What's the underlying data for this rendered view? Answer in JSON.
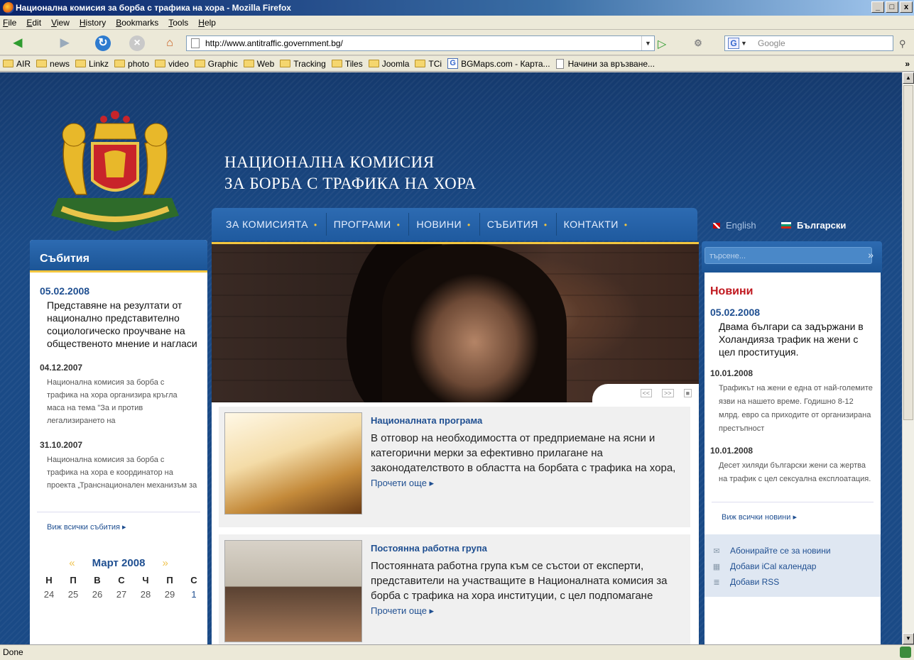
{
  "window": {
    "title": "Национална комисия за борба с трафика на хора - Mozilla Firefox",
    "controls": [
      "_",
      "□",
      "x"
    ]
  },
  "menu": [
    "File",
    "Edit",
    "View",
    "History",
    "Bookmarks",
    "Tools",
    "Help"
  ],
  "navbar": {
    "url": "http://www.antitraffic.government.bg/",
    "search_placeholder": "Google"
  },
  "bookmarks": [
    {
      "label": "AIR",
      "icon": "folder-icon"
    },
    {
      "label": "news",
      "icon": "folder-icon"
    },
    {
      "label": "Linkz",
      "icon": "folder-icon"
    },
    {
      "label": "photo",
      "icon": "folder-icon"
    },
    {
      "label": "video",
      "icon": "folder-icon"
    },
    {
      "label": "Graphic",
      "icon": "folder-icon"
    },
    {
      "label": "Web",
      "icon": "folder-icon"
    },
    {
      "label": "Tracking",
      "icon": "folder-icon"
    },
    {
      "label": "Tiles",
      "icon": "folder-icon"
    },
    {
      "label": "Joomla",
      "icon": "folder-icon"
    },
    {
      "label": "TCi",
      "icon": "folder-icon"
    },
    {
      "label": "BGMaps.com - Карта...",
      "icon": "google-icon"
    },
    {
      "label": "Начини за връзване...",
      "icon": "page-icon"
    }
  ],
  "site": {
    "title_line1": "НАЦИОНАЛНА КОМИСИЯ",
    "title_line2": "ЗА БОРБА С ТРАФИКА НА ХОРА",
    "nav": [
      "ЗА КОМИСИЯТА",
      "ПРОГРАМИ",
      "НОВИНИ",
      "СЪБИТИЯ",
      "КОНТАКТИ"
    ],
    "lang_en": "English",
    "lang_bg": "Български",
    "search_placeholder": "търсене..."
  },
  "events": {
    "heading": "Събития",
    "items": [
      {
        "date": "05.02.2008",
        "text": "Представяне на резултати от национално представително социологическо проучване на общественото мнение и нагласи"
      },
      {
        "date": "04.12.2007",
        "text": "Национална комисия за борба с трафика на хора организира кръгла маса на тема \"За и против легализирането на"
      },
      {
        "date": "31.10.2007",
        "text": "Национална комисия за борба с трафика на хора е координатор на проекта „Транснационален механизъм за"
      }
    ],
    "see_all": "Виж всички събития ▸"
  },
  "calendar": {
    "month": "Март 2008",
    "weekdays": [
      "Н",
      "П",
      "В",
      "С",
      "Ч",
      "П",
      "С"
    ],
    "first_row": [
      "24",
      "25",
      "26",
      "27",
      "28",
      "29",
      "1"
    ]
  },
  "hero": {
    "controls": [
      "<<",
      ">>",
      "■"
    ]
  },
  "articles": [
    {
      "title": "Националната програма",
      "text": "В отговор на необходимостта от предприемане на ясни и категорични мерки за ефективно прилагане на законодателството в областта на борбата с трафика на хора, ",
      "more": "Прочети още ▸"
    },
    {
      "title": "Постоянна работна група",
      "text": "Постоянната работна група към се състои от експерти, представители на участващите в Националната комисия за борба с трафика на хора институции, с цел подпомагане",
      "more": "Прочети още ▸"
    }
  ],
  "news": {
    "heading": "Новини",
    "items": [
      {
        "date": "05.02.2008",
        "text": "Двама българи са задържани в Холандияза трафик на жени с цел проституция."
      },
      {
        "date": "10.01.2008",
        "text": "Трафикът на жени е една от най-големите язви на нашето време. Годишно 8-12 млрд. евро са приходите от организирана престъпност"
      },
      {
        "date": "10.01.2008",
        "text": "Десет хиляди български жени са жертва на трафик с цел сексуална експлоатация."
      }
    ],
    "see_all": "Виж всички новини ▸",
    "links": [
      {
        "label": "Абонирайте се за новини",
        "icon": "envelope-icon"
      },
      {
        "label": "Добави iCal календар",
        "icon": "calendar-icon"
      },
      {
        "label": "Добави RSS",
        "icon": "rss-icon"
      }
    ]
  },
  "status": "Done",
  "colors": {
    "navy": "#1a4a86",
    "gold": "#f3c63f",
    "link": "#1f4f91",
    "news_red": "#c0181f"
  }
}
